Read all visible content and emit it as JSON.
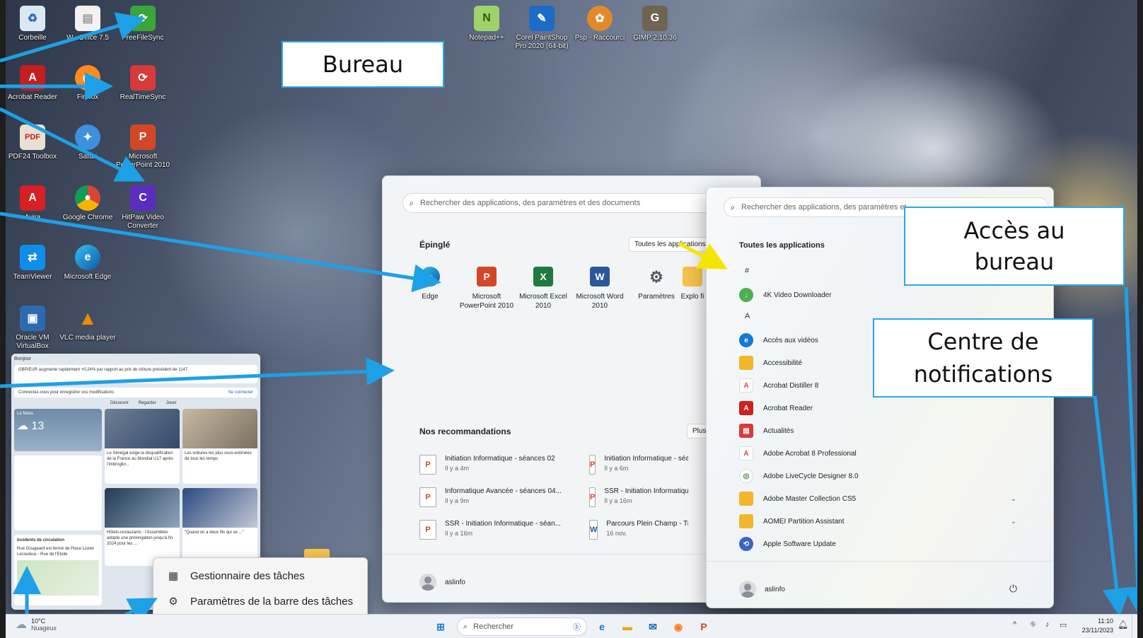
{
  "desktop": {
    "icons": [
      {
        "label": "Corbeille",
        "icon": "recycle-bin-icon"
      },
      {
        "label": "W...Office 7.5",
        "icon": "document-icon"
      },
      {
        "label": "FreeFileSync",
        "icon": "sync-icon"
      },
      {
        "label": "Acrobat Reader",
        "icon": "acrobat-icon"
      },
      {
        "label": "Firefox",
        "icon": "firefox-icon"
      },
      {
        "label": "RealTimeSync",
        "icon": "sync-icon"
      },
      {
        "label": "PDF24 Toolbox",
        "icon": "pdf24-icon"
      },
      {
        "label": "Safari",
        "icon": "safari-icon"
      },
      {
        "label": "Microsoft PowerPoint 2010",
        "icon": "powerpoint-icon"
      },
      {
        "label": "Avira",
        "icon": "avira-icon"
      },
      {
        "label": "Google Chrome",
        "icon": "chrome-icon"
      },
      {
        "label": "HitPaw Video Converter",
        "icon": "hitpaw-icon"
      },
      {
        "label": "TeamViewer",
        "icon": "teamviewer-icon"
      },
      {
        "label": "Microsoft Edge",
        "icon": "edge-icon"
      },
      {
        "label": "Oracle VM VirtualBox",
        "icon": "virtualbox-icon"
      },
      {
        "label": "VLC media player",
        "icon": "vlc-icon"
      },
      {
        "label": "Notepad++",
        "icon": "notepad-icon"
      },
      {
        "label": "Corel PaintShop Pro 2020 (64-bit)",
        "icon": "paintshop-icon"
      },
      {
        "label": "Psp - Raccourci",
        "icon": "palette-icon"
      },
      {
        "label": "GIMP 2.10.36",
        "icon": "gimp-icon"
      }
    ]
  },
  "callouts": {
    "bureau": "Bureau",
    "acces_line1": "Accès au",
    "acces_line2": "bureau",
    "centre_line1": "Centre de",
    "centre_line2": "notifications"
  },
  "start_menu": {
    "search_placeholder": "Rechercher des applications, des paramètres et des documents",
    "pinned_title": "Épinglé",
    "all_apps_button": "Toutes les applications",
    "pinned": [
      {
        "label": "Edge",
        "icon": "edge-icon"
      },
      {
        "label": "Microsoft PowerPoint 2010",
        "icon": "powerpoint-icon"
      },
      {
        "label": "Microsoft Excel 2010",
        "icon": "excel-icon"
      },
      {
        "label": "Microsoft Word 2010",
        "icon": "word-icon"
      },
      {
        "label": "Paramètres",
        "icon": "gear-icon"
      },
      {
        "label": "Explo fi",
        "icon": "folder-icon"
      }
    ],
    "recommendations_title": "Nos recommandations",
    "more_button": "Plus",
    "recommendations": [
      {
        "title": "Initiation Informatique - séances 02",
        "time": "Il y a 4m",
        "icon": "powerpoint-file-icon"
      },
      {
        "title": "Initiation Informatique - séa",
        "time": "Il y a 6m",
        "icon": "powerpoint-file-icon"
      },
      {
        "title": "Informatique Avancée - séances 04...",
        "time": "Il y a 9m",
        "icon": "powerpoint-file-icon"
      },
      {
        "title": "SSR - Initiation Informatique",
        "time": "Il y a 16m",
        "icon": "powerpoint-file-icon"
      },
      {
        "title": "SSR - Initiation Informatique - séan...",
        "time": "Il y a 16m",
        "icon": "powerpoint-file-icon"
      },
      {
        "title": "Parcours Plein Champ - Tran",
        "time": "16 nov.",
        "icon": "word-file-icon"
      }
    ],
    "user": "aslinfo"
  },
  "all_apps": {
    "search_placeholder": "Rechercher des applications, des paramètres et",
    "title": "Toutes les applications",
    "groups": [
      {
        "letter": "#",
        "apps": [
          {
            "label": "4K Video Downloader",
            "icon": "downloader-icon",
            "color": "#4caf50"
          }
        ]
      },
      {
        "letter": "A",
        "apps": [
          {
            "label": "Accès aux vidéos",
            "icon": "edge-icon",
            "color": "#0f7bd4"
          },
          {
            "label": "Accessibilité",
            "icon": "folder-icon",
            "color": "#f3b52b"
          },
          {
            "label": "Acrobat Distiller 8",
            "icon": "acrobat-icon",
            "color": "#e04848"
          },
          {
            "label": "Acrobat Reader",
            "icon": "acrobat-icon",
            "color": "#d01f1f"
          },
          {
            "label": "Actualités",
            "icon": "news-icon",
            "color": "#d83b3b"
          },
          {
            "label": "Adobe Acrobat 8 Professional",
            "icon": "acrobat-icon",
            "color": "#e04848"
          },
          {
            "label": "Adobe LiveCycle Designer 8.0",
            "icon": "livecycle-icon",
            "color": "#3e7a3e"
          },
          {
            "label": "Adobe Master Collection CS5",
            "icon": "folder-icon",
            "color": "#f3b52b",
            "expandable": true
          },
          {
            "label": "AOMEI Partition Assistant",
            "icon": "folder-icon",
            "color": "#f3b52b",
            "expandable": true
          },
          {
            "label": "Apple Software Update",
            "icon": "apple-update-icon",
            "color": "#3b63c4"
          }
        ]
      }
    ],
    "user": "aslinfo"
  },
  "widgets": {
    "greeting": "Bonjour",
    "headline": "GBP/EUR augmente rapidement +0,24% par rapport au prix de clôture précédent de 1147",
    "signin_notice": "Connectez-vous pour enregistrer vos modifications",
    "signin_link": "Se connecter",
    "tabs": [
      "Découvrir",
      "Regarder",
      "Jouer"
    ],
    "weather_city": "Le Mans",
    "weather_temp": "13",
    "news": [
      "Le Sénégal exige la disqualification de la France au Mondial U17 après l'imbroglio...",
      "Les voitures les plus sous-estimées de tous les temps",
      "Hôtels-restaurants : l'Assemblée adopte une prolongation jusqu'à fin 2024 pour les ...",
      "\"Quand on a deux fils qui se ...\""
    ],
    "traffic_title": "Incidents de circulation",
    "traffic_text": "Rue Gougeard est fermé de Place Lionel Lecouteux - Rue de l'Etoile"
  },
  "context_menu": {
    "items": [
      {
        "label": "Gestionnaire des tâches",
        "icon": "task-manager-icon"
      },
      {
        "label": "Paramètres de la barre des tâches",
        "icon": "gear-icon"
      }
    ]
  },
  "taskbar": {
    "weather_temp": "10°C",
    "weather_desc": "Nuageux",
    "search_placeholder": "Rechercher",
    "time": "11:10",
    "date": "23/11/2023",
    "tray_chevron": "^"
  },
  "colors": {
    "callout_border": "#2aa7e8",
    "arrow": "#1ea0e6",
    "yellow_arrow": "#f5e600"
  }
}
